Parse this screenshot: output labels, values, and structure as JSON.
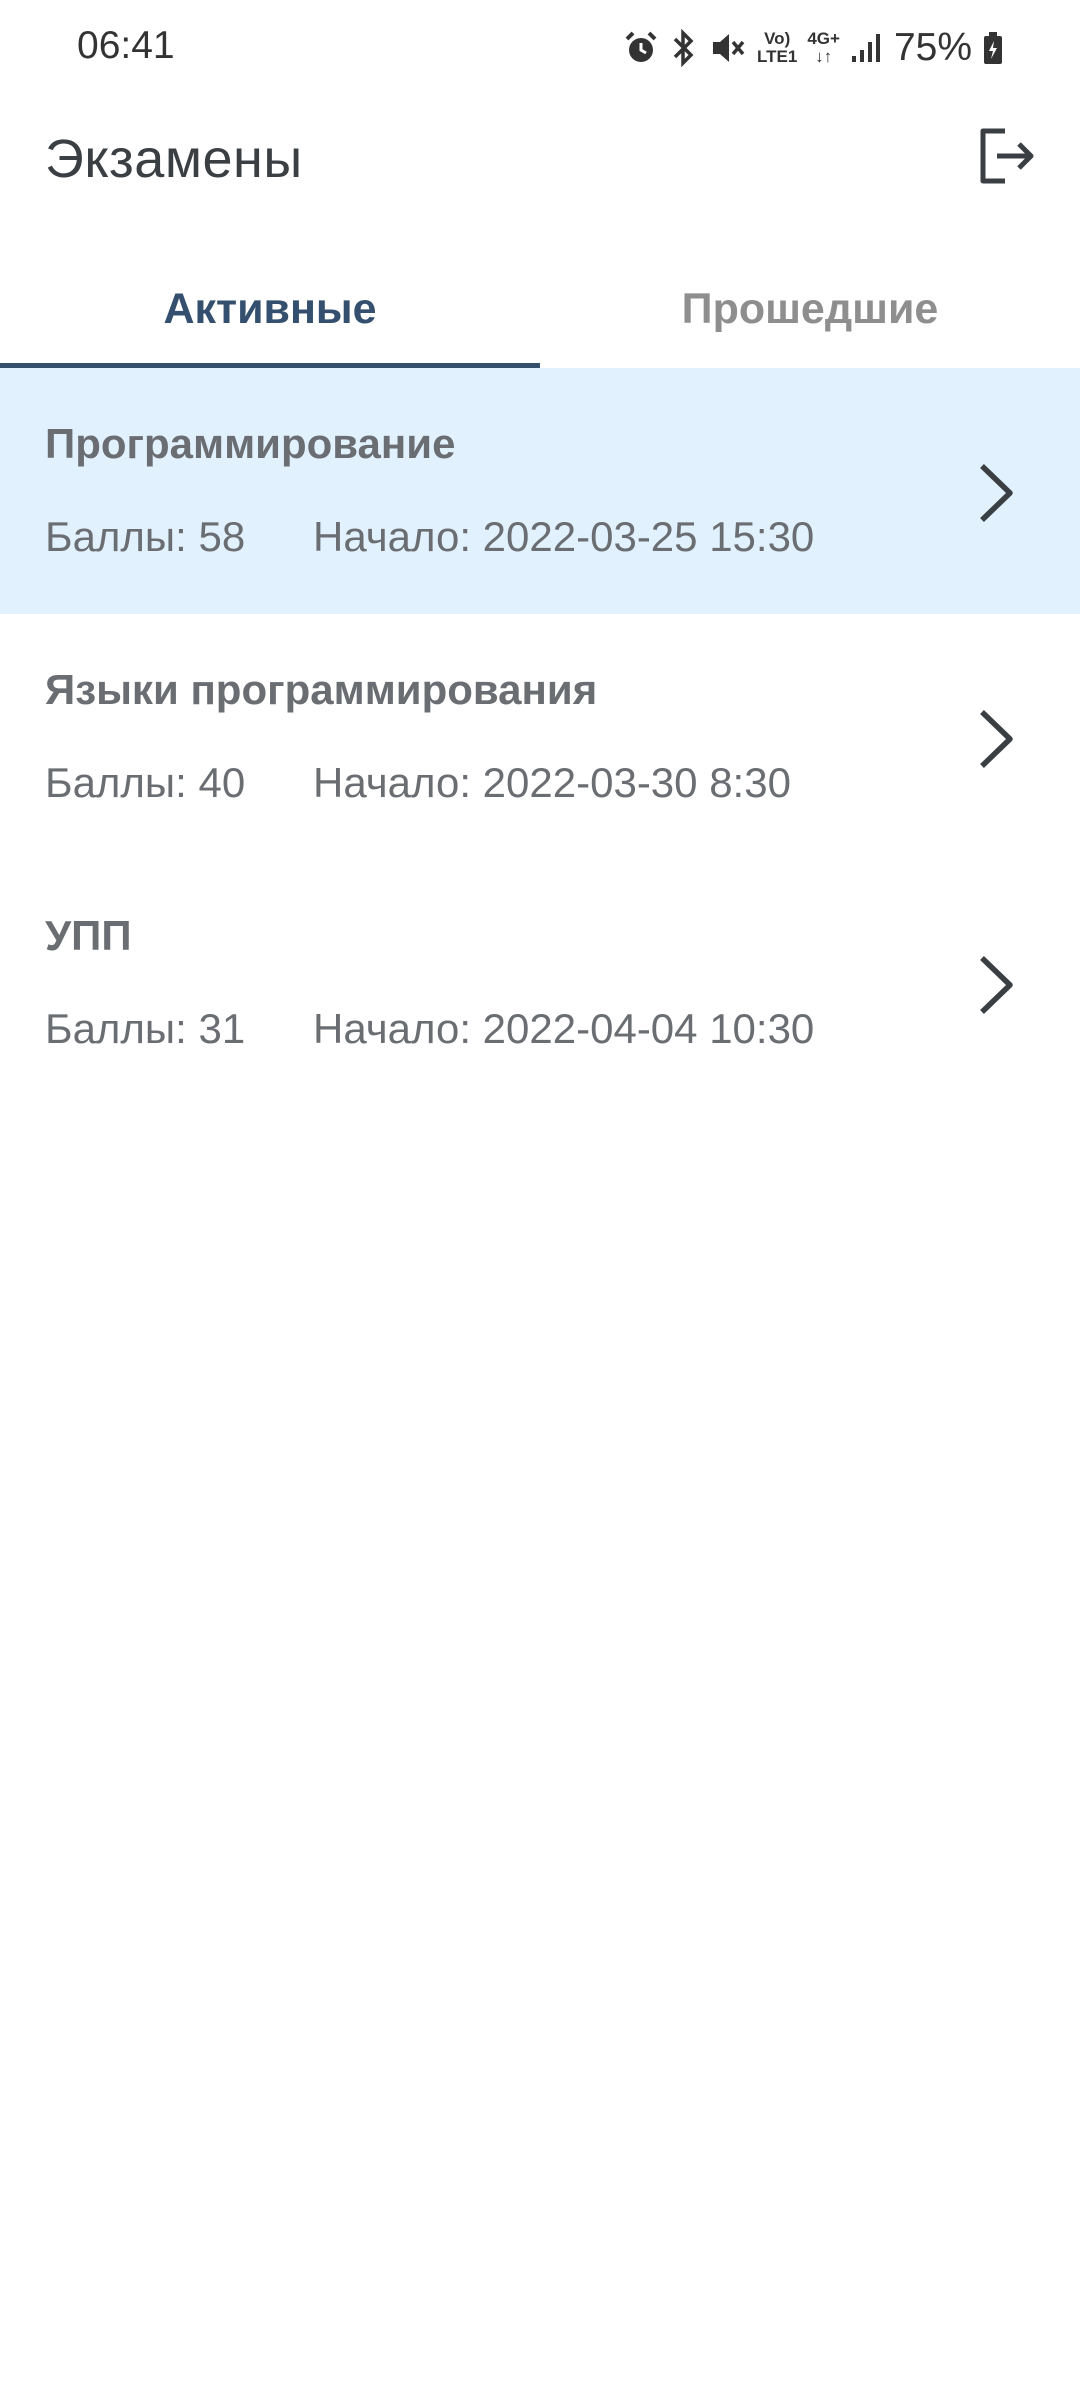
{
  "status_bar": {
    "time": "06:41",
    "network_top": "Vo)",
    "network_bottom": "LTE1",
    "data_type": "4G+",
    "battery": "75%",
    "icons": [
      "alarm-icon",
      "bluetooth-icon",
      "mute-icon",
      "volte-icon",
      "data-icon",
      "signal-icon",
      "battery-icon"
    ]
  },
  "app_bar": {
    "title": "Экзамены",
    "logout_icon": "logout-icon"
  },
  "tabs": [
    {
      "label": "Активные",
      "active": true
    },
    {
      "label": "Прошедшие",
      "active": false
    }
  ],
  "exams": [
    {
      "title": "Программирование",
      "score": "Баллы: 58",
      "start": "Начало: 2022-03-25 15:30",
      "selected": true
    },
    {
      "title": "Языки программирования",
      "score": "Баллы: 40",
      "start": "Начало: 2022-03-30 8:30",
      "selected": false
    },
    {
      "title": "УПП",
      "score": "Баллы: 31",
      "start": "Начало: 2022-04-04 10:30",
      "selected": false
    }
  ],
  "colors": {
    "accent": "#34506e",
    "selected_row": "#e1f1fd",
    "text_secondary": "#6a6e72",
    "tab_inactive": "#8e8e8e"
  }
}
